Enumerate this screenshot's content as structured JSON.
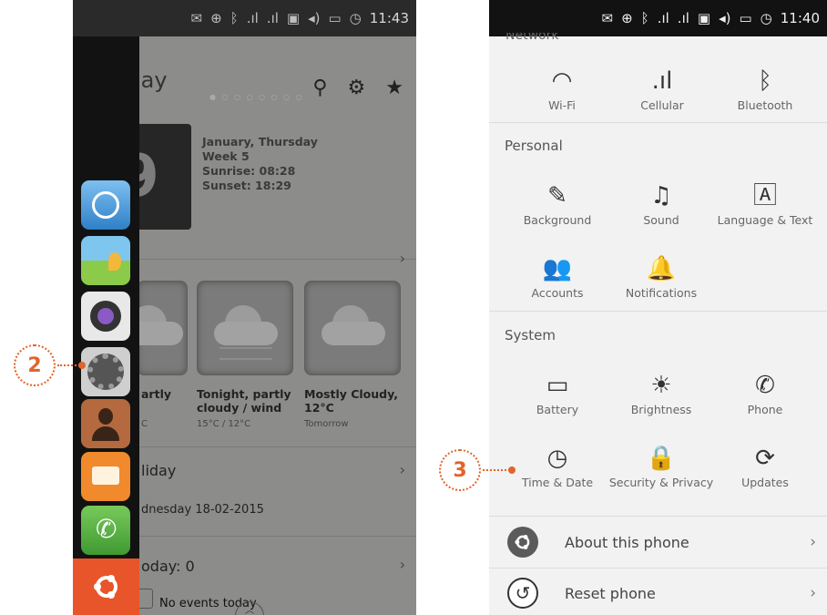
{
  "left": {
    "status_time": "11:43",
    "page_title": "Today",
    "title_visible": "lay",
    "date_number": "9",
    "date_info": [
      "January, Thursday",
      "Week 5",
      "Sunrise: 08:28",
      "Sunset: 18:29"
    ],
    "weather": [
      {
        "title": "artly",
        "sub": "C"
      },
      {
        "title": "Tonight, partly cloudy / wind",
        "sub": "15°C / 12°C"
      },
      {
        "title": "Mostly Cloudy, 12°C",
        "sub": "Tomorrow"
      }
    ],
    "holiday_label": "liday",
    "holiday_date": "dnesday 18-02-2015",
    "events_label": "oday: 0",
    "no_events": "No events today",
    "launcher_apps": [
      "browser-icon",
      "gallery-icon",
      "camera-icon",
      "system-settings-icon",
      "contacts-icon",
      "messaging-icon",
      "phone-icon"
    ],
    "callout": "2"
  },
  "right": {
    "status_time": "11:40",
    "network_cut": "Network",
    "network_items": [
      "Wi-Fi",
      "Cellular",
      "Bluetooth"
    ],
    "personal_title": "Personal",
    "personal_items": [
      "Background",
      "Sound",
      "Language & Text",
      "Accounts",
      "Notifications"
    ],
    "system_title": "System",
    "system_items": [
      "Battery",
      "Brightness",
      "Phone",
      "Time & Date",
      "Security & Privacy",
      "Updates"
    ],
    "about": "About this phone",
    "reset": "Reset phone",
    "callout": "3"
  },
  "colors": {
    "accent": "#e9552a",
    "callout": "#e0652a"
  }
}
